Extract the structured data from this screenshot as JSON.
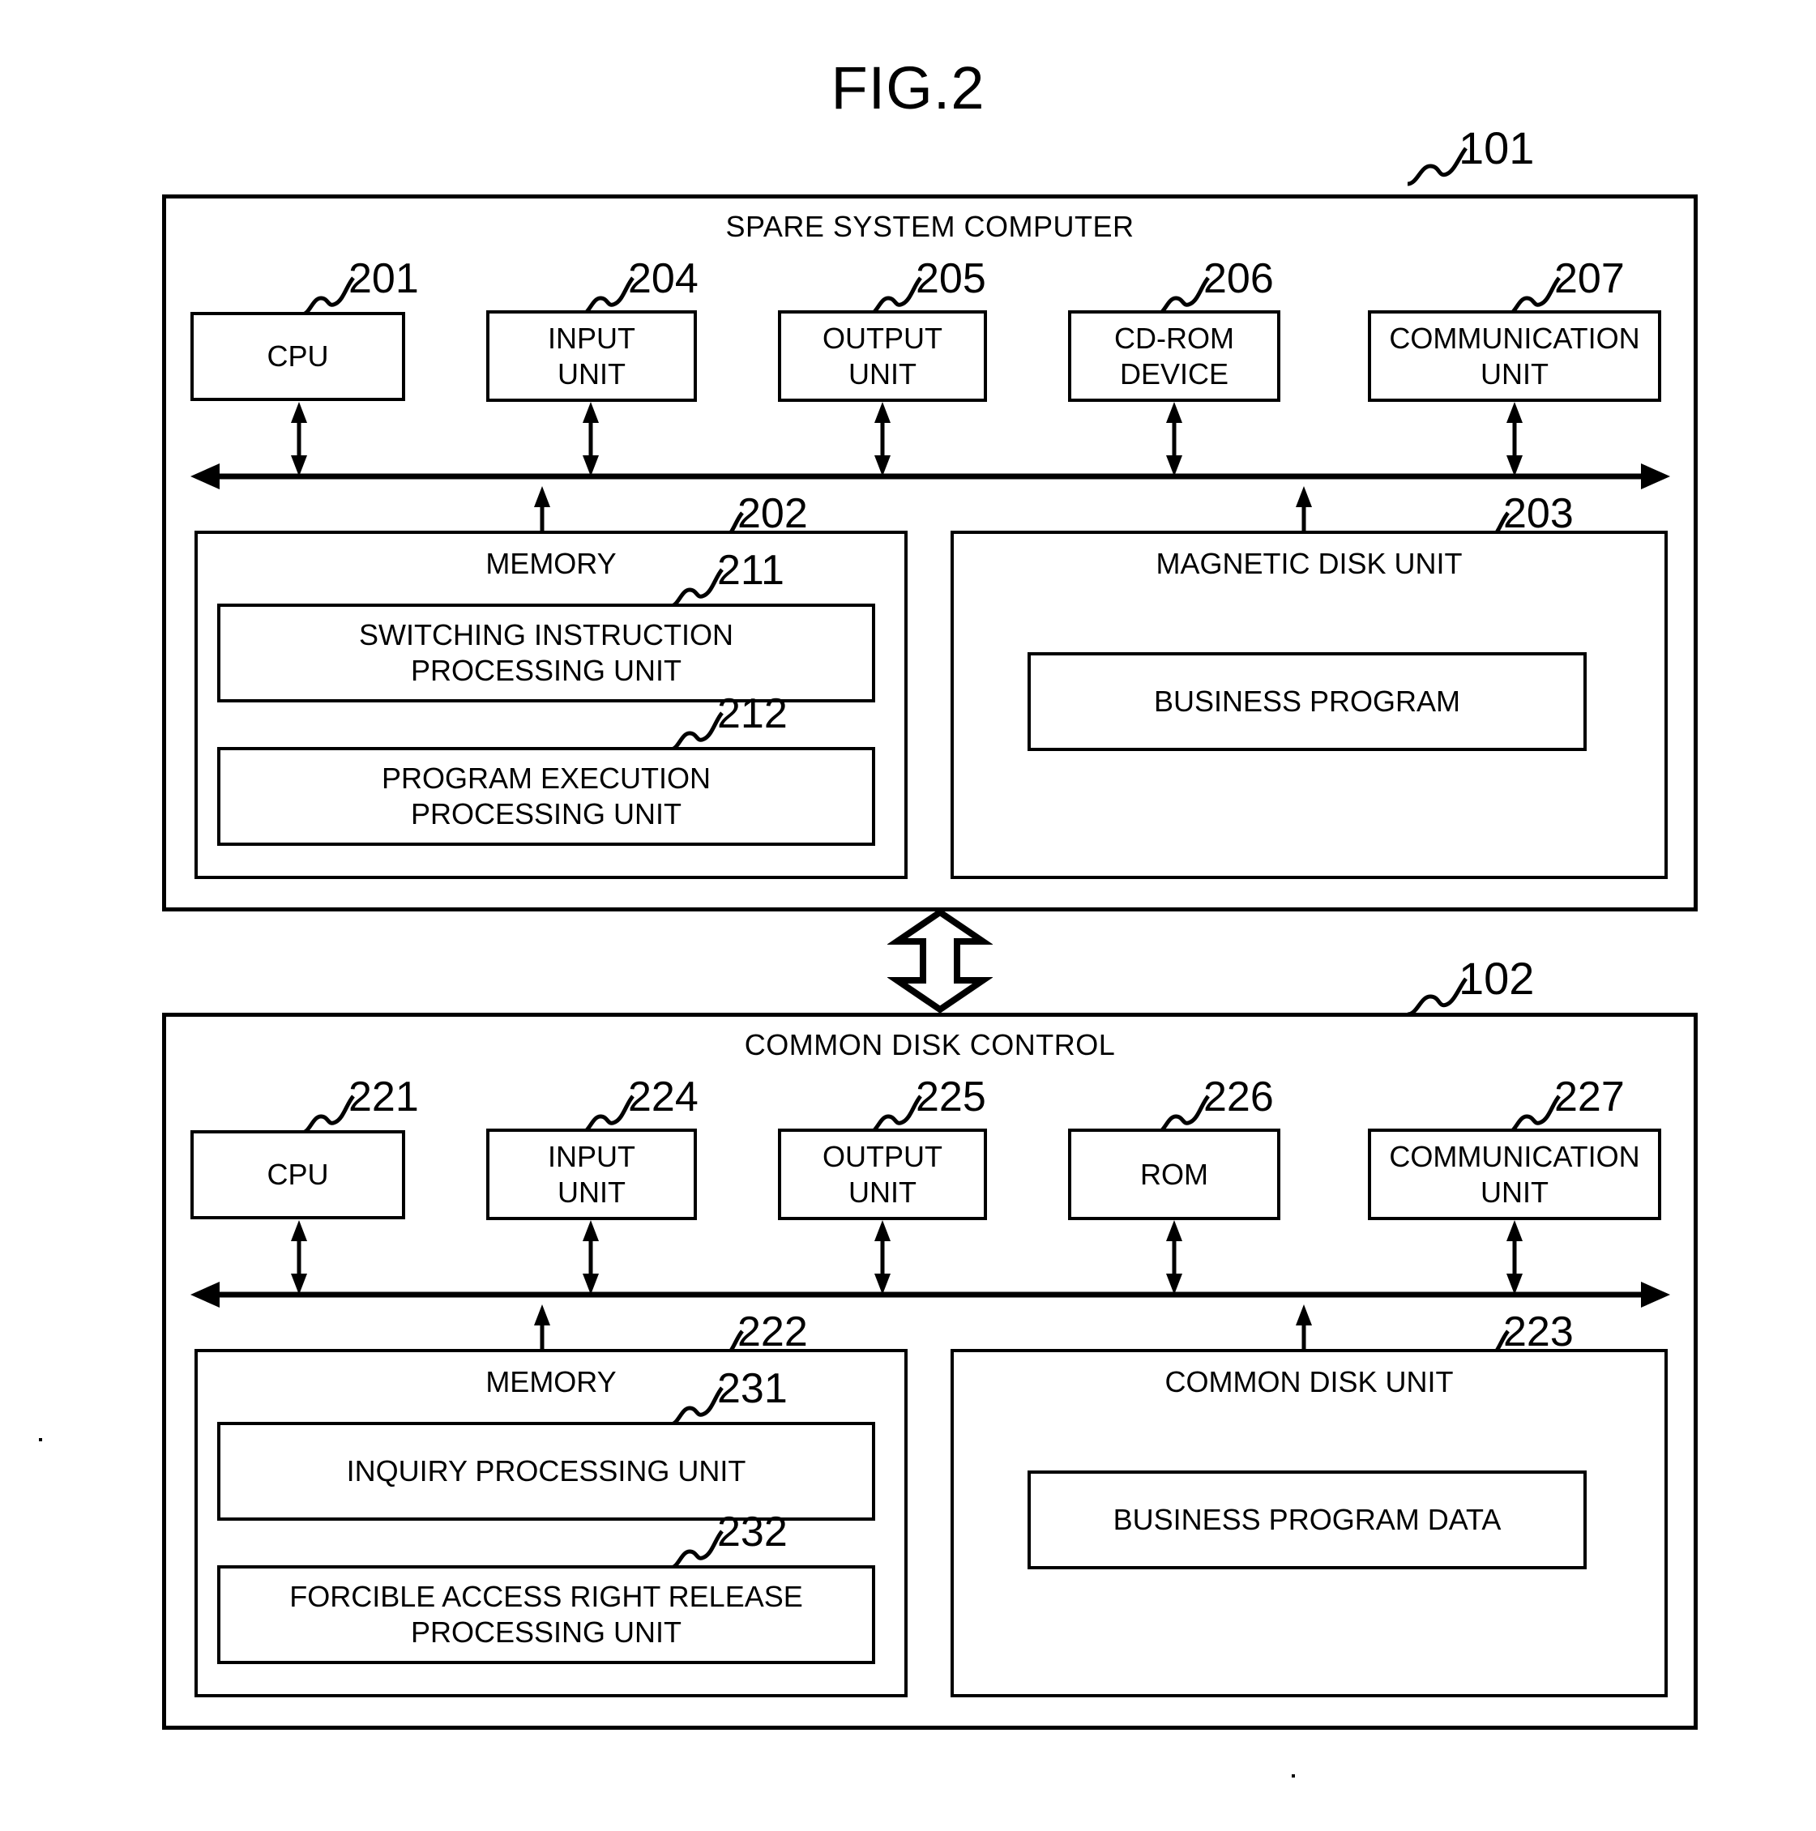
{
  "figure": {
    "title": "FIG.2"
  },
  "systems": [
    {
      "id": "spare-system-computer",
      "ref": "101",
      "title": "SPARE SYSTEM COMPUTER",
      "peripherals": [
        {
          "ref": "201",
          "label": "CPU"
        },
        {
          "ref": "204",
          "label": "INPUT\nUNIT"
        },
        {
          "ref": "205",
          "label": "OUTPUT\nUNIT"
        },
        {
          "ref": "206",
          "label": "CD-ROM\nDEVICE"
        },
        {
          "ref": "207",
          "label": "COMMUNICATION\nUNIT"
        }
      ],
      "memory": {
        "ref": "202",
        "title": "MEMORY",
        "modules": [
          {
            "ref": "211",
            "label": "SWITCHING INSTRUCTION\nPROCESSING UNIT"
          },
          {
            "ref": "212",
            "label": "PROGRAM EXECUTION\nPROCESSING UNIT"
          }
        ]
      },
      "storage": {
        "ref": "203",
        "title": "MAGNETIC DISK UNIT",
        "contents": [
          {
            "label": "BUSINESS PROGRAM"
          }
        ]
      }
    },
    {
      "id": "common-disk-control",
      "ref": "102",
      "title": "COMMON DISK CONTROL",
      "peripherals": [
        {
          "ref": "221",
          "label": "CPU"
        },
        {
          "ref": "224",
          "label": "INPUT\nUNIT"
        },
        {
          "ref": "225",
          "label": "OUTPUT\nUNIT"
        },
        {
          "ref": "226",
          "label": "ROM"
        },
        {
          "ref": "227",
          "label": "COMMUNICATION\nUNIT"
        }
      ],
      "memory": {
        "ref": "222",
        "title": "MEMORY",
        "modules": [
          {
            "ref": "231",
            "label": "INQUIRY PROCESSING UNIT"
          },
          {
            "ref": "232",
            "label": "FORCIBLE ACCESS RIGHT RELEASE\nPROCESSING UNIT"
          }
        ]
      },
      "storage": {
        "ref": "223",
        "title": "COMMON DISK UNIT",
        "contents": [
          {
            "label": "BUSINESS PROGRAM DATA"
          }
        ]
      }
    }
  ],
  "connector": {
    "name": "bidirectional-link"
  },
  "colors": {
    "line": "#000000",
    "background": "#ffffff"
  }
}
